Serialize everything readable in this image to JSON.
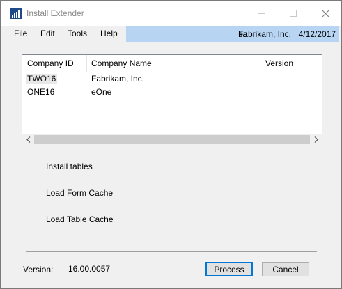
{
  "window": {
    "title": "Install Extender"
  },
  "menu": {
    "file": "File",
    "edit": "Edit",
    "tools": "Tools",
    "help": "Help"
  },
  "info": {
    "user": "sa",
    "company": "Fabrikam, Inc.",
    "date": "4/12/2017"
  },
  "grid": {
    "columns": [
      "Company ID",
      "Company Name",
      "Version"
    ],
    "rows": [
      {
        "id": "TWO16",
        "name": "Fabrikam, Inc.",
        "version": ""
      },
      {
        "id": "ONE16",
        "name": "eOne",
        "version": ""
      }
    ]
  },
  "steps": [
    "Install tables",
    "Load Form Cache",
    "Load Table Cache"
  ],
  "footer": {
    "version_label": "Version:",
    "version_value": "16.00.0057"
  },
  "buttons": {
    "process": "Process",
    "cancel": "Cancel"
  },
  "colors": {
    "accent": "#0078d7",
    "info_bar": "#b7d4f3"
  }
}
